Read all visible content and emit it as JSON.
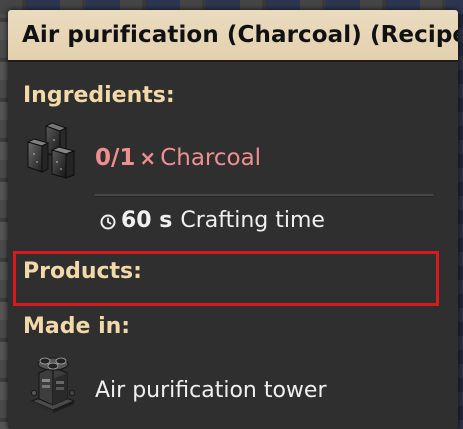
{
  "tooltip": {
    "title": "Air purification (Charcoal) (Recipe)",
    "ingredients_heading": "Ingredients:",
    "ingredient": {
      "count": "0/1",
      "times": "×",
      "name": "Charcoal",
      "icon": "charcoal-icon"
    },
    "crafting_time_value": "60 s",
    "crafting_time_label": "Crafting time",
    "products_heading": "Products:",
    "made_in_heading": "Made in:",
    "machine": {
      "name": "Air purification tower",
      "icon": "air-purification-tower-icon"
    }
  },
  "colors": {
    "title_bg": "#e6d4b3",
    "heading": "#f2d9aa",
    "insufficient_ingredient": "#f08f8f",
    "highlight_border": "#d71920",
    "body_bg": "#2f2f2f"
  }
}
